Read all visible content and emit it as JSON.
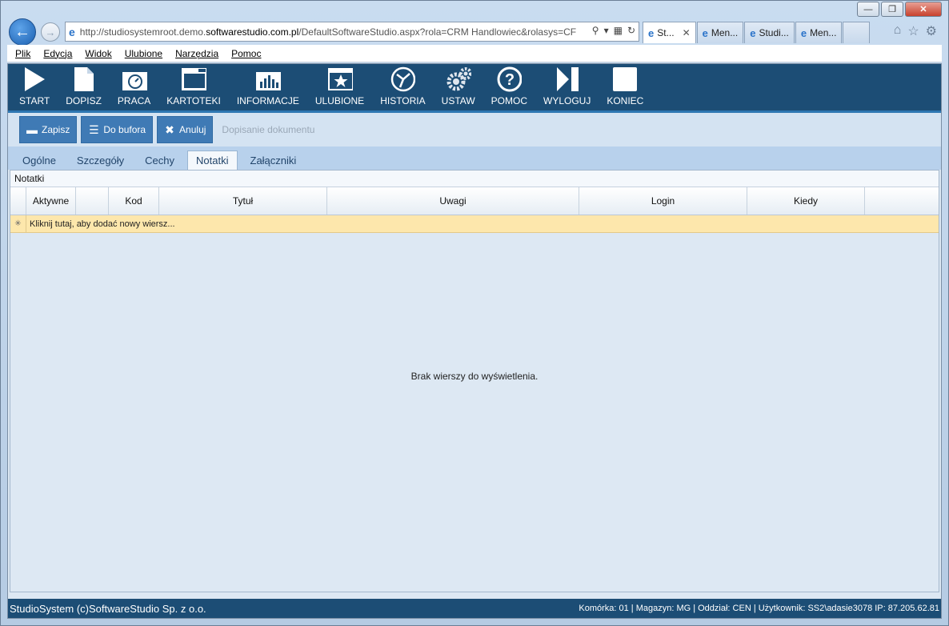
{
  "browser": {
    "url_prefix": "http://studiosystemroot.demo.",
    "url_domain": "softwarestudio.com.pl",
    "url_suffix": "/DefaultSoftwareStudio.aspx?rola=CRM Handlowiec&rolasys=CF",
    "tabs": [
      {
        "label": "St...",
        "active": true
      },
      {
        "label": "Men...",
        "active": false
      },
      {
        "label": "Studi...",
        "active": false
      },
      {
        "label": "Men...",
        "active": false
      }
    ]
  },
  "menubar": {
    "items": [
      "Plik",
      "Edycja",
      "Widok",
      "Ulubione",
      "Narzędzia",
      "Pomoc"
    ]
  },
  "toolbar": {
    "items": [
      {
        "label": "START",
        "icon": "play-icon"
      },
      {
        "label": "DOPISZ",
        "icon": "document-icon"
      },
      {
        "label": "PRACA",
        "icon": "gauge-icon"
      },
      {
        "label": "KARTOTEKI",
        "icon": "window-icon"
      },
      {
        "label": "INFORMACJE",
        "icon": "chart-icon"
      },
      {
        "label": "ULUBIONE",
        "icon": "star-icon"
      },
      {
        "label": "HISTORIA",
        "icon": "clock-icon"
      },
      {
        "label": "USTAW",
        "icon": "gears-icon"
      },
      {
        "label": "POMOC",
        "icon": "help-icon"
      },
      {
        "label": "WYLOGUJ",
        "icon": "logout-icon"
      },
      {
        "label": "KONIEC",
        "icon": "stop-icon"
      }
    ]
  },
  "subbar": {
    "save_label": "Zapisz",
    "buffer_label": "Do bufora",
    "cancel_label": "Anuluj",
    "note": "Dopisanie dokumentu"
  },
  "doc_tabs": {
    "items": [
      {
        "label": "Ogólne",
        "active": false
      },
      {
        "label": "Szczegóły",
        "active": false
      },
      {
        "label": "Cechy",
        "active": false
      },
      {
        "label": "Notatki",
        "active": true
      },
      {
        "label": "Załączniki",
        "active": false
      }
    ]
  },
  "panel": {
    "title": "Notatki",
    "columns": [
      "",
      "Aktywne",
      "",
      "Kod",
      "Tytuł",
      "Uwagi",
      "Login",
      "Kiedy",
      ""
    ],
    "new_row_text": "Kliknij tutaj, aby dodać nowy wiersz...",
    "empty_text": "Brak wierszy do wyświetlenia."
  },
  "status": {
    "left": "StudioSystem (c)SoftwareStudio Sp. z o.o.",
    "right": "Komórka: 01 | Magazyn: MG | Oddział: CEN | Użytkownik: SS2\\adasie3078 IP: 87.205.62.81"
  }
}
